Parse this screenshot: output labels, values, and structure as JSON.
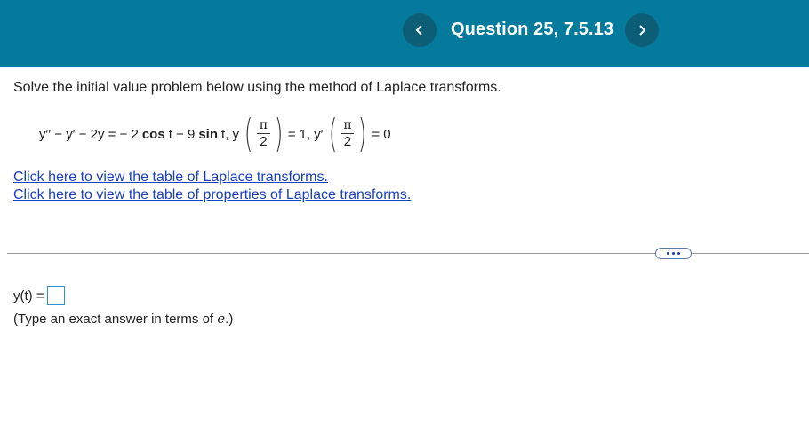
{
  "header": {
    "title": "Question 25, 7.5.13",
    "prev_label": "<",
    "next_label": ">",
    "bg_color": "#047A9C"
  },
  "problem": {
    "instruction": "Solve the initial value problem below using the method of Laplace transforms.",
    "equation": {
      "lhs": "y′′ − y′ − 2y = − 2",
      "cos": "cos",
      "t_minus_9": "t − 9",
      "sin": "sin",
      "t_comma_y": "t, y",
      "pi": "π",
      "two": "2",
      "eq_1_y": "= 1, y′",
      "eq_0": "= 0"
    },
    "links": [
      "Click here to view the table of Laplace transforms.",
      "Click here to view the table of properties of Laplace transforms."
    ]
  },
  "answer": {
    "label": "y(t) =",
    "value": "",
    "hint_prefix": "(Type an exact answer in terms of ",
    "hint_e": "e",
    "hint_suffix": ".)"
  }
}
